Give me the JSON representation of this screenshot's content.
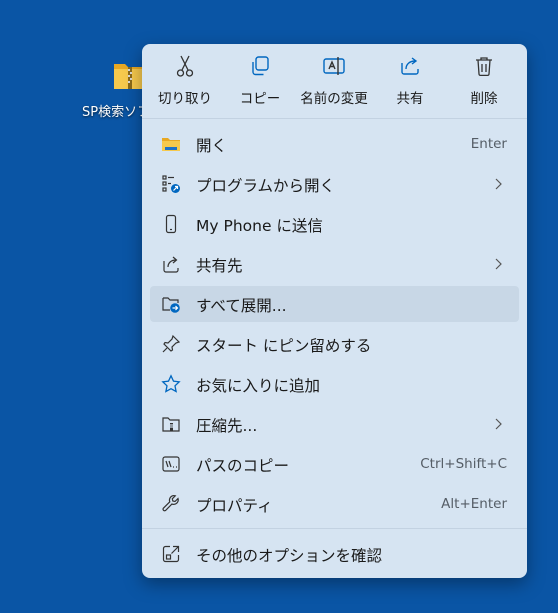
{
  "desktop": {
    "icon_label": "SP検索ソフ",
    "icon_name": "zip-folder-icon"
  },
  "quick_actions": [
    {
      "label": "切り取り",
      "icon": "cut-icon"
    },
    {
      "label": "コピー",
      "icon": "copy-icon"
    },
    {
      "label": "名前の変更",
      "icon": "rename-icon"
    },
    {
      "label": "共有",
      "icon": "share-icon"
    },
    {
      "label": "削除",
      "icon": "delete-icon"
    }
  ],
  "menu_items": [
    {
      "label": "開く",
      "shortcut": "Enter",
      "icon": "folder-icon"
    },
    {
      "label": "プログラムから開く",
      "shortcut": "",
      "icon": "open-with-icon",
      "submenu": true
    },
    {
      "label": "My Phone に送信",
      "shortcut": "",
      "icon": "phone-icon"
    },
    {
      "label": "共有先",
      "shortcut": "",
      "icon": "share-to-icon",
      "submenu": true
    },
    {
      "label": "すべて展開...",
      "shortcut": "",
      "icon": "extract-icon",
      "highlighted": true
    },
    {
      "label": "スタート にピン留めする",
      "shortcut": "",
      "icon": "pin-icon"
    },
    {
      "label": "お気に入りに追加",
      "shortcut": "",
      "icon": "star-icon"
    },
    {
      "label": "圧縮先...",
      "shortcut": "",
      "icon": "compress-icon",
      "submenu": true
    },
    {
      "label": "パスのコピー",
      "shortcut": "Ctrl+Shift+C",
      "icon": "copy-path-icon"
    },
    {
      "label": "プロパティ",
      "shortcut": "Alt+Enter",
      "icon": "wrench-icon"
    }
  ],
  "more_options": {
    "label": "その他のオプションを確認",
    "icon": "more-options-icon"
  },
  "colors": {
    "desktop_bg": "#0a55a5",
    "menu_bg": "#d6e4f2",
    "highlight_bg": "#c8d7e6",
    "accent": "#0067c0",
    "folder_yellow": "#f3c14b"
  }
}
